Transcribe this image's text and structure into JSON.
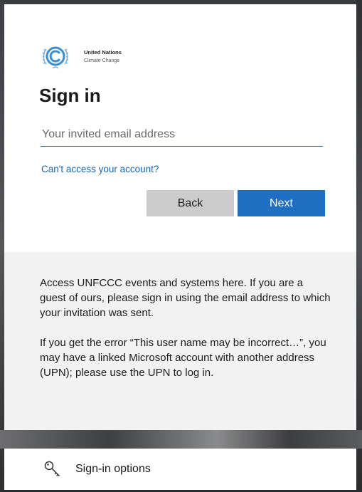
{
  "logo": {
    "line1": "United Nations",
    "line2": "Climate Change",
    "icon": "unfccc-logo-icon"
  },
  "signin": {
    "title": "Sign in",
    "email_placeholder": "Your invited email address",
    "email_value": "",
    "cant_access_link": "Can't access your account?",
    "back_label": "Back",
    "next_label": "Next"
  },
  "info": {
    "paragraph1": "Access UNFCCC events and systems here. If you are a guest of ours, please sign in using the email address to which your invitation was sent.",
    "paragraph2": "If you get the error “This user name may be incorrect…”, you may have a linked Microsoft account with another address (UPN); please use the UPN to log in."
  },
  "options": {
    "label": "Sign-in options",
    "icon": "key-icon"
  },
  "colors": {
    "accent": "#1e6ec1",
    "link": "#1565b5",
    "back_button": "#cccccc",
    "info_background": "#f2f2f2",
    "logo_blue": "#3a8fd3"
  }
}
